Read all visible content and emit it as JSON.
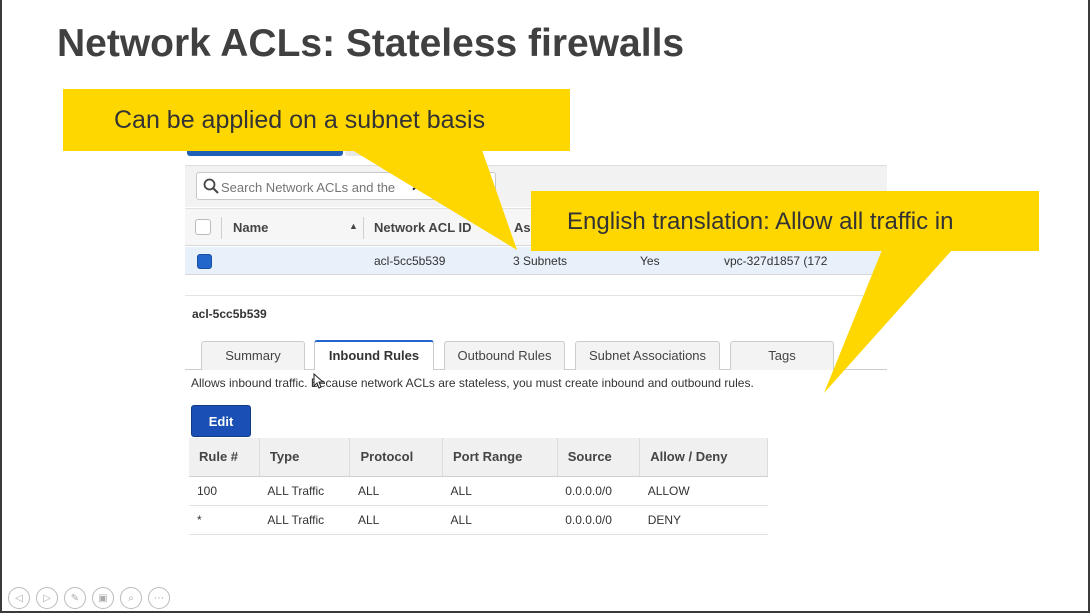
{
  "slide": {
    "title": "Network ACLs: Stateless firewalls"
  },
  "callouts": {
    "subnet": "Can be applied on a subnet basis",
    "translation": "English translation: Allow all traffic in"
  },
  "console": {
    "search": {
      "placeholder": "Search Network ACLs and the"
    },
    "list": {
      "columns": [
        "Name",
        "Network ACL ID",
        "Ass"
      ],
      "row": {
        "name": "",
        "acl_id": "acl-5cc5b539",
        "associated": "3 Subnets",
        "default": "Yes",
        "vpc": "vpc-327d1857 (172"
      }
    },
    "detail": {
      "title": "acl-5cc5b539",
      "tabs": [
        "Summary",
        "Inbound Rules",
        "Outbound Rules",
        "Subnet Associations",
        "Tags"
      ],
      "active_tab": "Inbound Rules",
      "description": "Allows inbound traffic. Because network ACLs are stateless, you must create inbound and outbound rules.",
      "edit_label": "Edit",
      "rules_columns": [
        "Rule #",
        "Type",
        "Protocol",
        "Port Range",
        "Source",
        "Allow / Deny"
      ],
      "rules": [
        {
          "rule": "100",
          "type": "ALL Traffic",
          "protocol": "ALL",
          "port": "ALL",
          "source": "0.0.0.0/0",
          "action": "ALLOW"
        },
        {
          "rule": "*",
          "type": "ALL Traffic",
          "protocol": "ALL",
          "port": "ALL",
          "source": "0.0.0.0/0",
          "action": "DENY"
        }
      ]
    }
  },
  "colors": {
    "callout": "#ffd700",
    "allow": "#1b9e2c",
    "deny": "#cc1f1f",
    "primary_button": "#1a4fb5"
  },
  "nav_icons": [
    "previous-icon",
    "next-icon",
    "pen-icon",
    "slides-icon",
    "zoom-icon",
    "more-icon"
  ]
}
